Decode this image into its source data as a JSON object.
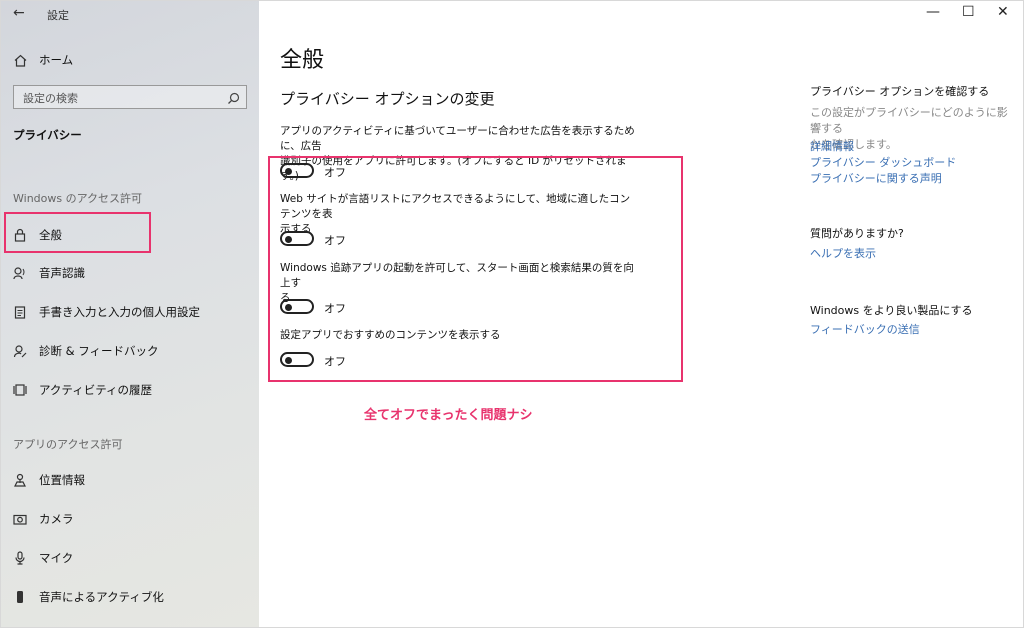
{
  "window": {
    "title": "設定",
    "controls": [
      "—",
      "☐",
      "✕"
    ]
  },
  "sidebar": {
    "home_label": "ホーム",
    "search_placeholder": "設定の検索",
    "section_title": "プライバシー",
    "windows_perm_header": "Windows のアクセス許可",
    "windows_items": [
      {
        "label": "全般",
        "icon": "lock-icon",
        "selected": true
      },
      {
        "label": "音声認識",
        "icon": "speech-icon"
      },
      {
        "label": "手書き入力と入力の個人用設定",
        "icon": "handwriting-icon"
      },
      {
        "label": "診断 & フィードバック",
        "icon": "feedback-icon"
      },
      {
        "label": "アクティビティの履歴",
        "icon": "history-icon"
      }
    ],
    "app_perm_header": "アプリのアクセス許可",
    "app_items": [
      {
        "label": "位置情報",
        "icon": "location-icon"
      },
      {
        "label": "カメラ",
        "icon": "camera-icon"
      },
      {
        "label": "マイク",
        "icon": "microphone-icon"
      },
      {
        "label": "音声によるアクティブ化",
        "icon": "voice-activation-icon"
      }
    ]
  },
  "main": {
    "title": "全般",
    "subtitle": "プライバシー オプションの変更",
    "options": [
      {
        "desc_line1": "アプリのアクティビティに基づいてユーザーに合わせた広告を表示するために、広告",
        "desc_line2": "識別子の使用をアプリに許可します。(オフにすると ID がリセットされます。)",
        "state": "オフ"
      },
      {
        "desc_line1": "Web サイトが言語リストにアクセスできるようにして、地域に適したコンテンツを表",
        "desc_line2": "示する",
        "state": "オフ"
      },
      {
        "desc_line1": "Windows 追跡アプリの起動を許可して、スタート画面と検索結果の質を向上す",
        "desc_line2": "る",
        "state": "オフ"
      },
      {
        "desc_line1": "設定アプリでおすすめのコンテンツを表示する",
        "desc_line2": "",
        "state": "オフ"
      }
    ],
    "annotation": "全てオフでまったく問題ナシ",
    "annotation_color": "#e8336d"
  },
  "right": {
    "privacy_head": "プライバシー オプションを確認する",
    "privacy_text_line1": "この設定がプライバシーにどのように影響する",
    "privacy_text_line2": "かを確認します。",
    "links": [
      "詳細情報",
      "プライバシー ダッシュボード",
      "プライバシーに関する声明"
    ],
    "question_head": "質問がありますか?",
    "help_link": "ヘルプを表示",
    "improve_head": "Windows をより良い製品にする",
    "feedback_link": "フィードバックの送信",
    "link_color": "#3a6fb3"
  }
}
